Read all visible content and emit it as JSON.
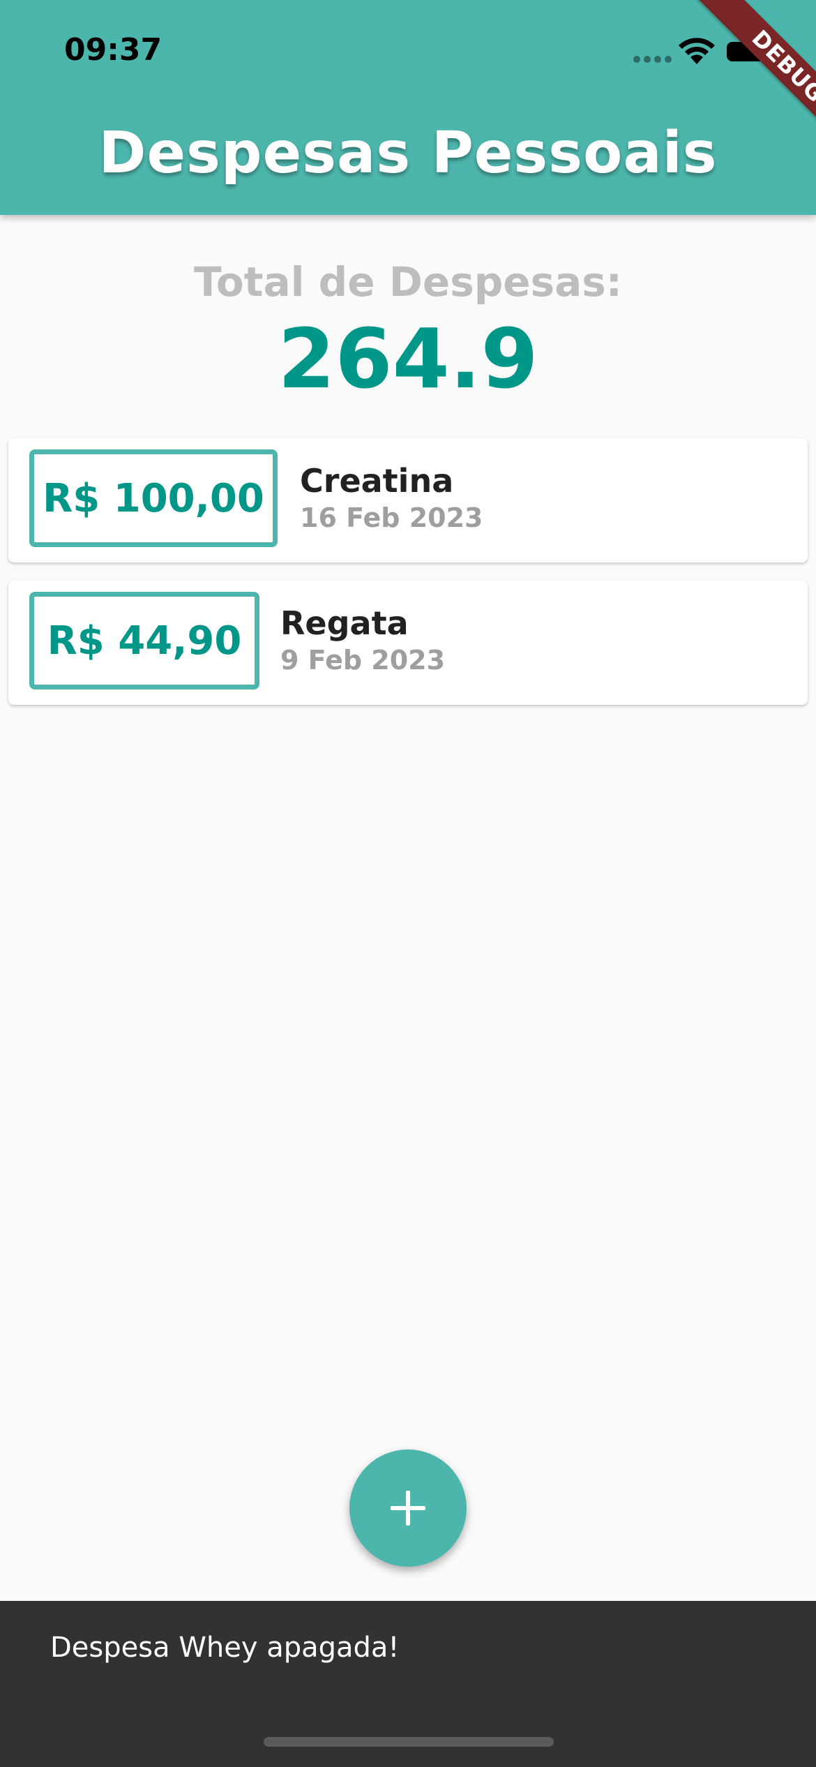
{
  "status_bar": {
    "time": "09:37",
    "icons": [
      "signal-icon",
      "wifi-icon",
      "battery-icon"
    ]
  },
  "debug_banner": "DEBUG",
  "app_bar": {
    "title": "Despesas Pessoais",
    "color": "#4DB6AC"
  },
  "summary": {
    "label": "Total de Despesas:",
    "value": "264.9",
    "value_color": "#009688"
  },
  "transactions": [
    {
      "amount": "R$ 100,00",
      "title": "Creatina",
      "date": "16 Feb 2023"
    },
    {
      "amount": "R$ 44,90",
      "title": "Regata",
      "date": "9 Feb 2023"
    }
  ],
  "fab": {
    "icon": "plus-icon"
  },
  "snackbar": {
    "message": "Despesa Whey apagada!"
  }
}
